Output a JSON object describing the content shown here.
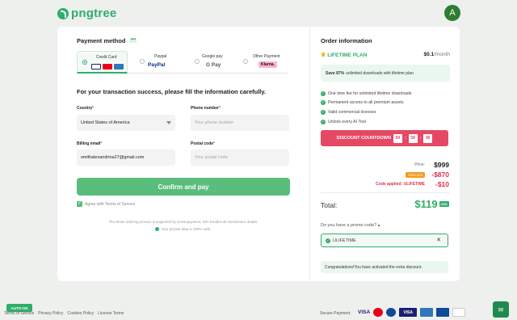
{
  "header": {
    "logo_text": "pngtree",
    "avatar_initial": "A"
  },
  "payment": {
    "title": "Payment method",
    "tabs": [
      {
        "label": "Credit Card",
        "active": true
      },
      {
        "label": "Paypal",
        "brand": "PayPal"
      },
      {
        "label": "Google pay",
        "brand": "G Pay"
      },
      {
        "label": "Other Payment",
        "brand": "Klarna."
      }
    ],
    "instruction": "For your transaction success, please fill the information carefully.",
    "country_label": "Country",
    "country_value": "United States of America",
    "phone_label": "Phone number",
    "phone_placeholder": "Your phone number",
    "email_label": "Billing email",
    "email_value": "smithalexandrina27@gmail.com",
    "postal_label": "Postal code",
    "postal_placeholder": "Your postal code",
    "confirm_label": "Confirm and pay",
    "agree_text": "Agree with Terms of Service",
    "support_text": "The whole ordering process is supported by Oceanpayment, who handles all transactions details.",
    "private_text": "Your private data is 100% safe."
  },
  "order": {
    "title": "Order information",
    "plan_name": "LIFETIME PLAN",
    "plan_price": "$0.1",
    "plan_period": "/month",
    "save_bold": "Save 87%",
    "save_text": "unlimited downloads with lifetime plan",
    "features": [
      "One time fee for unlimited lifetime downloads",
      "Permanent access to all premium assets",
      "Valid commercial licenses",
      "Unlock every AI Tool"
    ],
    "countdown_label": "DISCOUNT COUNTDOWN",
    "countdown": [
      "59",
      "58",
      "96"
    ],
    "price_label": "Price:",
    "price_value": "$999",
    "discount_label": "Discount",
    "discount_value": "-$870",
    "code_label": "Code applied: ULIFETIME",
    "code_value": "-$10",
    "total_label": "Total:",
    "total_value": "$119",
    "currency": "USD",
    "promo_question": "Do you have a promo code?",
    "promo_code": "ULIFETIME",
    "congrats": "Congratulations!You have activated the extra discount."
  },
  "footer": {
    "auto_on": "AUTO-ON",
    "links": [
      "Terms of Service",
      "Privacy Policy",
      "Cookies Policy",
      "License Terms"
    ],
    "secure_label": "Secure Payment:",
    "visa": "VISA",
    "visa_box": "VISA"
  },
  "colors": {
    "accent": "#2fae6b",
    "countdown": "#e54863",
    "discount": "#e0314b"
  }
}
